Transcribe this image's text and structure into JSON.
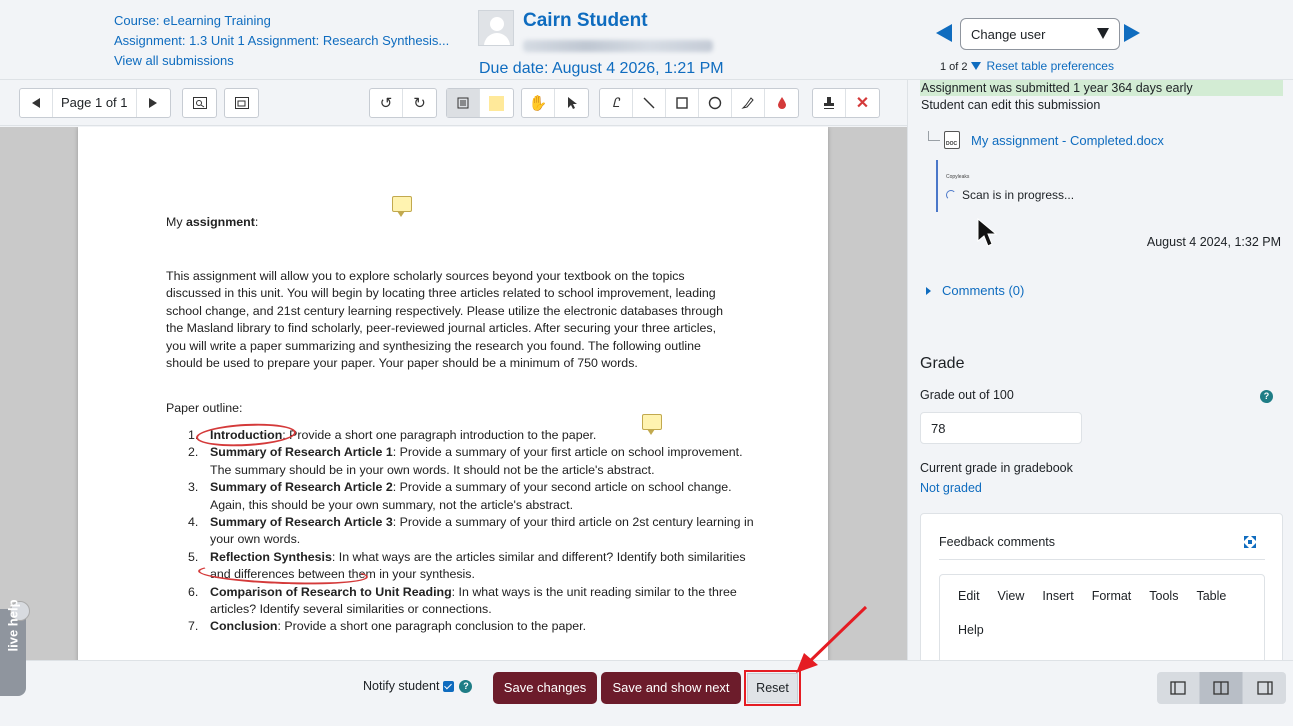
{
  "header": {
    "course_link": "Course: eLearning Training",
    "assignment_link": "Assignment: 1.3 Unit 1 Assignment: Research Synthesis...",
    "view_all": "View all submissions",
    "user_name": "Cairn Student",
    "due_date": "Due date: August 4 2026, 1:21 PM",
    "change_user": "Change user",
    "pager_count": "1 of 2",
    "reset_prefs": "Reset table preferences"
  },
  "toolbar": {
    "page_label": "Page 1 of 1"
  },
  "document": {
    "heading_prefix": "My ",
    "heading_bold": "assignment",
    "heading_suffix": ":",
    "intro": "This assignment will allow you to explore scholarly sources beyond your textbook on the topics discussed in this unit. You will begin by locating three articles related to school improvement, leading school change, and 21st century learning respectively. Please utilize the electronic databases through the Masland library to find scholarly, peer-reviewed journal articles. After securing your three articles, you will write a paper summarizing and synthesizing the research you found. The following outline should be used to prepare your paper. Your paper should be a minimum of 750 words.",
    "outline_label": "Paper outline:",
    "outline": [
      {
        "num": "1.",
        "title": "Introduction",
        "text": ": Provide a short one paragraph introduction to the paper."
      },
      {
        "num": "2.",
        "title": "Summary of Research Article 1",
        "text": ": Provide a summary of your first article on school improvement. The summary should be in your own words. It should not be the article's abstract."
      },
      {
        "num": "3.",
        "title": "Summary of Research Article 2",
        "text": ": Provide a summary of your second article on school change. Again, this should be your own summary, not the article's abstract."
      },
      {
        "num": "4.",
        "title": "Summary of Research Article 3",
        "text": ": Provide a summary of your third article on 2st century learning in your own words."
      },
      {
        "num": "5.",
        "title": "Reflection Synthesis",
        "text": ": In what ways are the articles similar and different? Identify both similarities and differences between them in your synthesis."
      },
      {
        "num": "6.",
        "title": "Comparison of Research to Unit Reading",
        "text": ": In what ways is the unit reading similar to the three articles? Identify several similarities or connections."
      },
      {
        "num": "7.",
        "title": "Conclusion",
        "text": ": Provide a short one paragraph conclusion to the paper."
      }
    ]
  },
  "panel": {
    "submitted_status": "Assignment was submitted 1 year 364 days early",
    "can_edit": "Student can edit this submission",
    "file_name": "My assignment - Completed.docx",
    "plag_logo": "Copyleaks",
    "scan_status": "Scan is in progress...",
    "submission_date": "August 4 2024, 1:32 PM",
    "comments": "Comments (0)",
    "grade_heading": "Grade",
    "grade_out_of": "Grade out of 100",
    "grade_value": "78",
    "current_grade_label": "Current grade in gradebook",
    "not_graded": "Not graded",
    "feedback_title": "Feedback comments",
    "editor_menu": [
      "Edit",
      "View",
      "Insert",
      "Format",
      "Tools",
      "Table",
      "Help"
    ]
  },
  "bottom": {
    "notify_label": "Notify student",
    "save_changes": "Save changes",
    "save_next": "Save and show next",
    "reset": "Reset",
    "live_help": "live help"
  },
  "colors": {
    "link": "#0f6cbf",
    "primary_button": "#6c1c2b",
    "annotation": "#e51c23",
    "status_success": "#d3ecd4"
  }
}
